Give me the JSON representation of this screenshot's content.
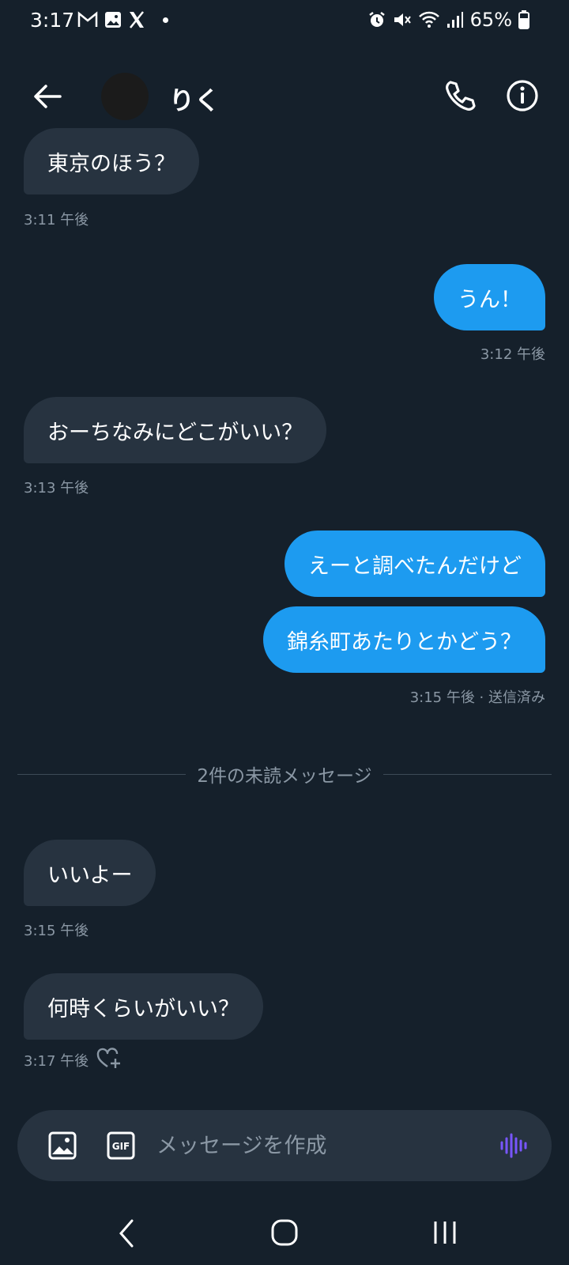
{
  "status_bar": {
    "time": "3:17",
    "battery": "65%",
    "icons_left": [
      "gmail-icon",
      "gallery-icon",
      "x-icon",
      "notification-dot"
    ],
    "icons_right": [
      "alarm-icon",
      "mute-icon",
      "wifi-icon",
      "signal-icon",
      "battery-icon"
    ]
  },
  "header": {
    "contact_name": "りく",
    "icons": [
      "back-arrow-icon",
      "phone-icon",
      "info-icon"
    ]
  },
  "messages": [
    {
      "direction": "in",
      "text": "東京のほう？",
      "meta": "3:11 午後"
    },
    {
      "direction": "out",
      "text": "うん！",
      "meta": "3:12 午後"
    },
    {
      "direction": "in",
      "text": "おーちなみにどこがいい？",
      "meta": "3:13 午後"
    },
    {
      "direction": "out",
      "text": "えーと調べたんだけど"
    },
    {
      "direction": "out",
      "text": "錦糸町あたりとかどう？",
      "meta": "3:15 午後 · 送信済み"
    },
    {
      "direction": "in",
      "text": "いいよー",
      "meta": "3:15 午後"
    },
    {
      "direction": "in",
      "text": "何時くらいがいい？",
      "meta": "3:17 午後"
    }
  ],
  "unread_divider": "2件の未読メッセージ",
  "composer": {
    "placeholder": "メッセージを作成",
    "gif_label": "GIF"
  },
  "colors": {
    "background": "#15202b",
    "incoming_bubble": "#273340",
    "outgoing_bubble": "#1d9bf0",
    "meta_text": "#8b98a5",
    "voice_accent": "#7856ff"
  }
}
